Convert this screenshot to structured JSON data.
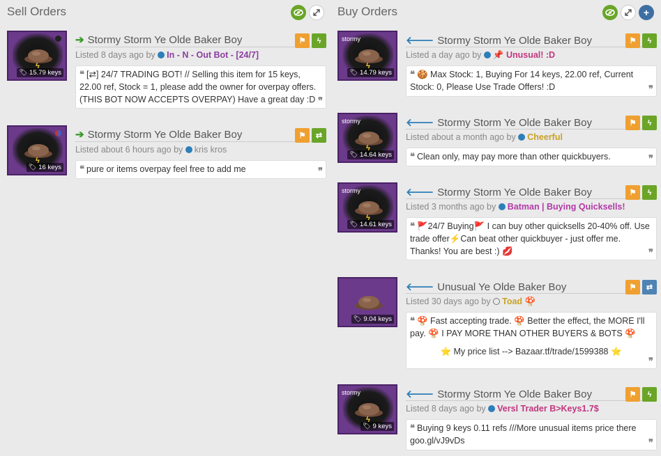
{
  "sell": {
    "title": "Sell Orders",
    "listings": [
      {
        "thumb_tag": "",
        "price": "15.79 keys",
        "title": "Stormy Storm Ye Olde Baker Boy",
        "listed": "Listed 8 days ago by",
        "user": "In - N - Out Bot - [24/7]",
        "user_color": "#8b3fa0",
        "comment": "[⇄] 24/7 TRADING BOT! // Selling this item for 15 keys, 22.00 ref, Stock = 1, please add the owner for overpay offers. (THIS BOT NOW ACCEPTS OVERPAY) Have a great day :D"
      },
      {
        "thumb_tag": "",
        "price": "16 keys",
        "title": "Stormy Storm Ye Olde Baker Boy",
        "listed": "Listed about 6 hours ago by",
        "user": "kris kros",
        "user_color": "#888888",
        "comment": "pure or items overpay feel free to add me"
      }
    ]
  },
  "buy": {
    "title": "Buy Orders",
    "listings": [
      {
        "thumb_tag": "stormy",
        "price": "14.79 keys",
        "title": "Stormy Storm Ye Olde Baker Boy",
        "listed": "Listed a day ago by",
        "user": "📌 Unusual! :D",
        "user_color": "#c2367f",
        "comment": "🍪 Max Stock: 1, Buying For 14 keys, 22.00 ref, Current Stock: 0, Please Use Trade Offers! :D"
      },
      {
        "thumb_tag": "stormy",
        "price": "14.64 keys",
        "title": "Stormy Storm Ye Olde Baker Boy",
        "listed": "Listed about a month ago by",
        "user": "Cheerful",
        "user_color": "#c9a227",
        "comment": "Clean only, may pay more than other quickbuyers."
      },
      {
        "thumb_tag": "stormy",
        "price": "14.61 keys",
        "title": "Stormy Storm Ye Olde Baker Boy",
        "listed": "Listed 3 months ago by",
        "user": "Batman",
        "user_suffix": " | Buying Quicksells!",
        "user_color": "#b13aa6",
        "comment": "🚩24/7 Buying🚩 I can buy other quicksells 20-40% off. Use trade offer⚡Can beat other quickbuyer - just offer me. Thanks! You are best :) 💋"
      },
      {
        "thumb_tag": "",
        "price": "9.04 keys",
        "title": "Unusual Ye Olde Baker Boy",
        "listed": "Listed 30 days ago by",
        "user": "Toad 🍄",
        "user_color": "#c9a227",
        "comment": "🍄 Fast accepting trade. 🍄 Better the effect, the MORE I'll pay. 🍄 I PAY MORE THAN OTHER BUYERS & BOTS 🍄",
        "comment2": "⭐   My price list --> Bazaar.tf/trade/1599388   ⭐"
      },
      {
        "thumb_tag": "stormy",
        "price": "9 keys",
        "title": "Stormy Storm Ye Olde Baker Boy",
        "listed": "Listed 8 days ago by",
        "user": "Versl Trader B>Keys1.7$",
        "user_color": "#c2367f",
        "comment": "Buying 9 keys 0.11 refs ///More unusual items price there goo.gl/vJ9vDs"
      }
    ]
  },
  "icons": {
    "eye": "eye-icon",
    "expand": "expand-icon",
    "plus": "plus-icon",
    "flag": "flag-icon",
    "lightning": "lightning-icon",
    "exchange": "exchange-icon"
  }
}
